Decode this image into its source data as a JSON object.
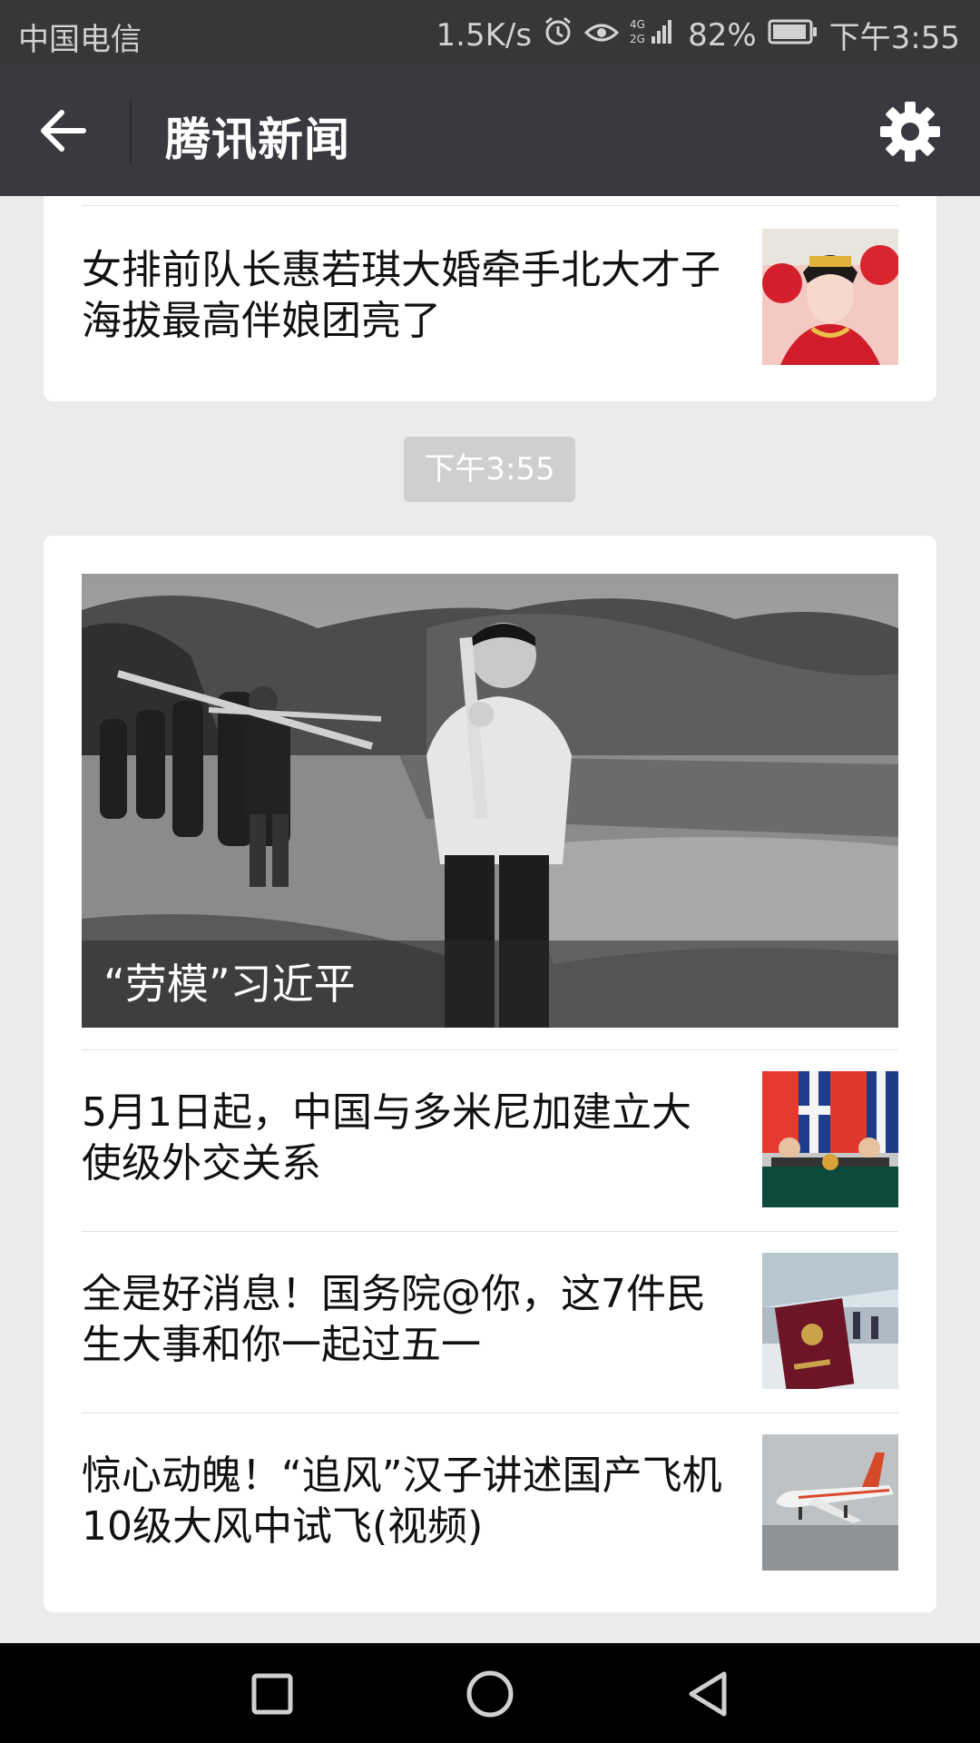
{
  "status_bar": {
    "carrier": "中国电信",
    "speed": "1.5K/s",
    "network": "4G 2G",
    "battery": "82%",
    "time": "下午3:55",
    "icons": [
      "alarm-icon",
      "eye-icon",
      "signal-icon",
      "battery-icon"
    ]
  },
  "header": {
    "title": "腾讯新闻",
    "back_icon": "back-arrow-icon",
    "settings_icon": "gear-icon"
  },
  "feed": {
    "top_item": {
      "title": "女排前队长惠若琪大婚牵手北大才子 海拔最高伴娘团亮了",
      "thumb": "bride-photo"
    },
    "time_separator": "下午3:55",
    "hero": {
      "caption": "“劳模”习近平",
      "image": "bw-field-photo"
    },
    "items": [
      {
        "title": "5月1日起，中国与多米尼加建立大使级外交关系",
        "thumb": "flags-signing-photo"
      },
      {
        "title": "全是好消息！国务院@你，这7件民生大事和你一起过五一",
        "thumb": "passport-airport-photo"
      },
      {
        "title": "惊心动魄！“追风”汉子讲述国产飞机10级大风中试飞(视频)",
        "thumb": "airplane-photo"
      }
    ]
  },
  "nav": {
    "recent_icon": "square-icon",
    "home_icon": "circle-icon",
    "back_icon": "triangle-back-icon"
  },
  "colors": {
    "header_bg": "#393a3f",
    "status_bg": "#37373a",
    "page_bg": "#ebebeb",
    "badge_bg": "#cfcfcf"
  }
}
